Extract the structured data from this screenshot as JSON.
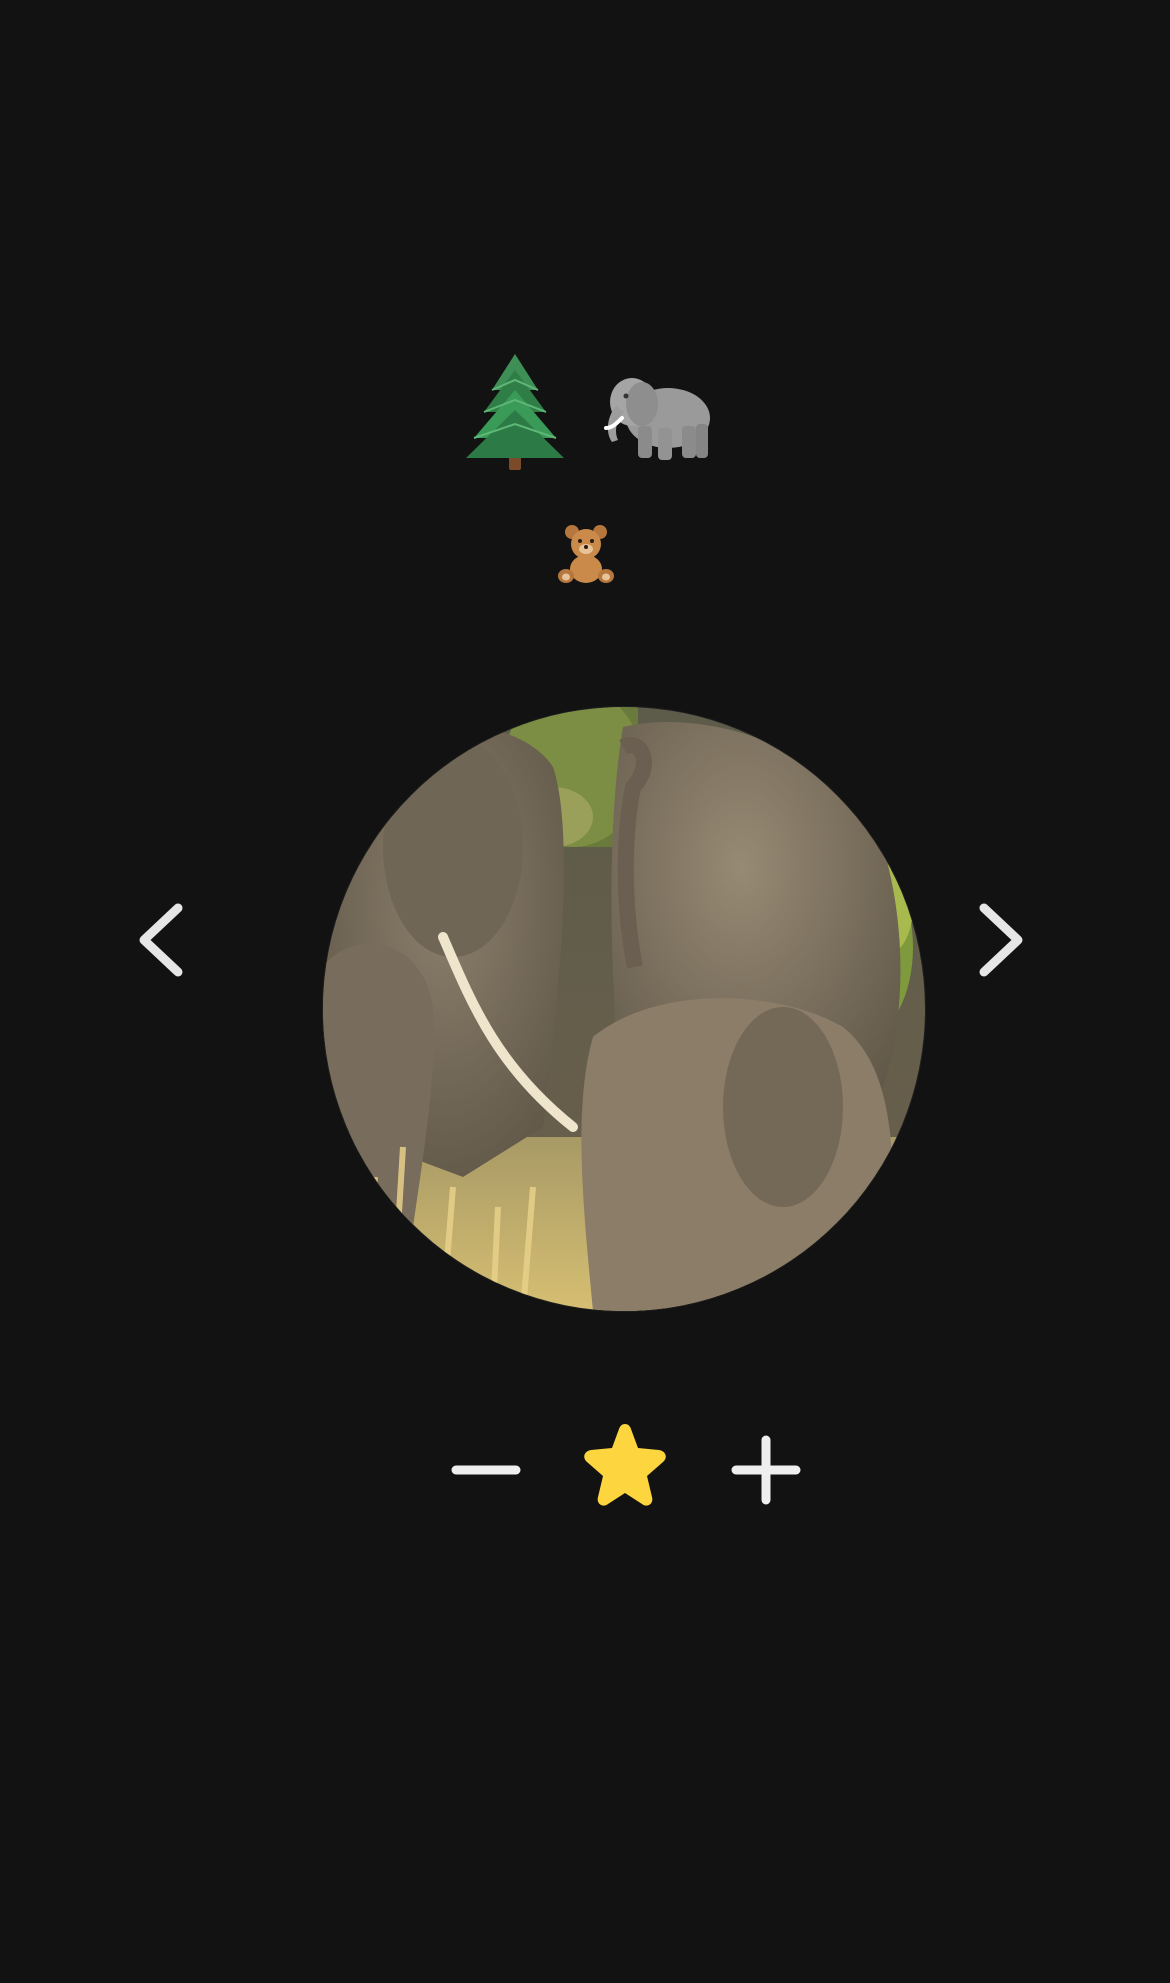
{
  "colors": {
    "background": "#121212",
    "arrow": "#e6e6e6",
    "control": "#efefef",
    "star": "#fcd53f"
  },
  "icons": {
    "row1": [
      "evergreen-tree-icon",
      "elephant-icon"
    ],
    "row2": [
      "teddy-bear-icon"
    ],
    "nav": [
      "chevron-left-icon",
      "chevron-right-icon"
    ],
    "controls": [
      "minus-icon",
      "star-icon",
      "plus-icon"
    ]
  },
  "photo": {
    "subject": "elephants"
  }
}
